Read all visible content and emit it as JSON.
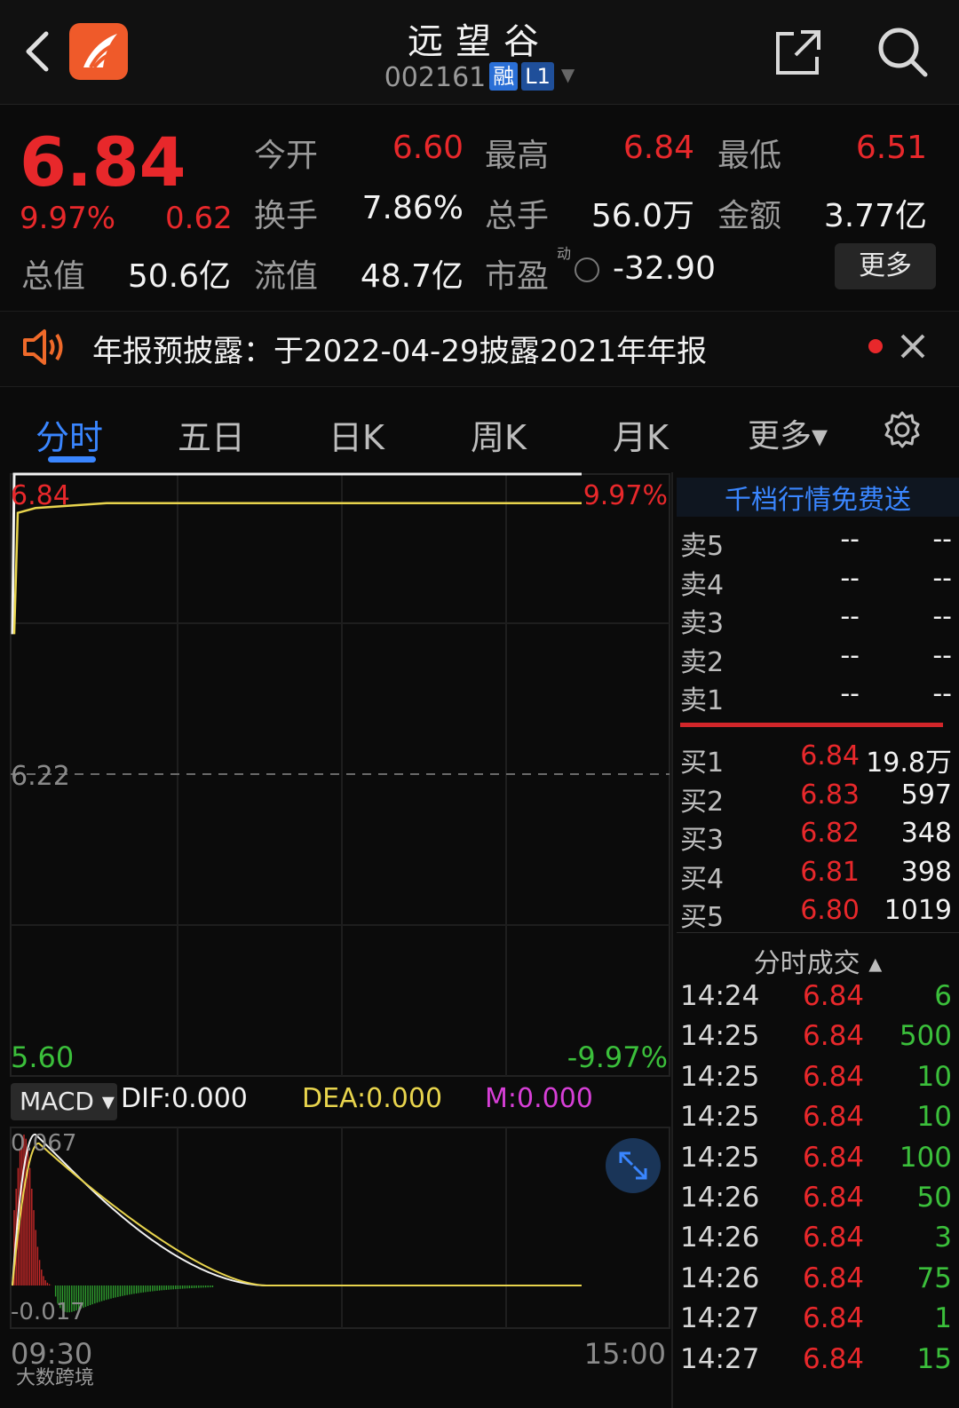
{
  "header": {
    "stock_name": "远望谷",
    "stock_code": "002161",
    "tag_margin": "融",
    "tag_level": "L1"
  },
  "quote": {
    "price": "6.84",
    "pct_change": "9.97%",
    "change": "0.62",
    "fields": [
      {
        "label": "今开",
        "value": "6.60",
        "color": "red"
      },
      {
        "label": "最高",
        "value": "6.84",
        "color": "red"
      },
      {
        "label": "最低",
        "value": "6.51",
        "color": "red"
      },
      {
        "label": "换手",
        "value": "7.86%",
        "color": "white"
      },
      {
        "label": "总手",
        "value": "56.0万",
        "color": "white"
      },
      {
        "label": "金额",
        "value": "3.77亿",
        "color": "white"
      },
      {
        "label": "总值",
        "value": "50.6亿",
        "color": "white"
      },
      {
        "label": "流值",
        "value": "48.7亿",
        "color": "white"
      },
      {
        "label": "市盈",
        "value": "-32.90",
        "color": "white"
      }
    ],
    "pe_mark": "动",
    "more_label": "更多"
  },
  "notice": {
    "text": "年报预披露：于2022-04-29披露2021年年报"
  },
  "tabs": [
    {
      "label": "分时",
      "active": true
    },
    {
      "label": "五日"
    },
    {
      "label": "日K"
    },
    {
      "label": "周K"
    },
    {
      "label": "月K"
    },
    {
      "label": "更多▾"
    }
  ],
  "chart": {
    "price_top": "6.84",
    "pct_top": "9.97%",
    "price_mid": "6.22",
    "price_bottom": "5.60",
    "pct_bottom": "-9.97%",
    "time_start": "09:30",
    "time_end": "15:00",
    "macd_label": "MACD ▾",
    "dif": "DIF:0.000",
    "dea": "DEA:0.000",
    "m": "M:0.000",
    "macd_top": "0.067",
    "macd_bottom": "-0.017",
    "watermark": "大数跨境"
  },
  "chart_data": {
    "type": "line",
    "title": "",
    "ylim": [
      5.6,
      6.84
    ],
    "y_mid": 6.22,
    "x": [
      "09:30",
      "15:00"
    ],
    "series": [
      {
        "values": [
          6.51,
          6.84,
          6.84,
          6.84,
          6.84,
          6.84
        ]
      },
      {
        "values": [
          6.51,
          6.76,
          6.77,
          6.78,
          6.78,
          6.78,
          6.78
        ]
      }
    ]
  },
  "depth": {
    "promo": "千档行情免费送",
    "asks": [
      {
        "label": "卖5",
        "price": "--",
        "vol": "--"
      },
      {
        "label": "卖4",
        "price": "--",
        "vol": "--"
      },
      {
        "label": "卖3",
        "price": "--",
        "vol": "--"
      },
      {
        "label": "卖2",
        "price": "--",
        "vol": "--"
      },
      {
        "label": "卖1",
        "price": "--",
        "vol": "--"
      }
    ],
    "bids": [
      {
        "label": "买1",
        "price": "6.84",
        "vol": "19.8万"
      },
      {
        "label": "买2",
        "price": "6.83",
        "vol": "597"
      },
      {
        "label": "买3",
        "price": "6.82",
        "vol": "348"
      },
      {
        "label": "买4",
        "price": "6.81",
        "vol": "398"
      },
      {
        "label": "买5",
        "price": "6.80",
        "vol": "1019"
      }
    ]
  },
  "ticks": {
    "title": "分时成交 ▴",
    "rows": [
      {
        "time": "14:24",
        "price": "6.84",
        "vol": "6"
      },
      {
        "time": "14:25",
        "price": "6.84",
        "vol": "500"
      },
      {
        "time": "14:25",
        "price": "6.84",
        "vol": "10"
      },
      {
        "time": "14:25",
        "price": "6.84",
        "vol": "10"
      },
      {
        "time": "14:25",
        "price": "6.84",
        "vol": "100"
      },
      {
        "time": "14:26",
        "price": "6.84",
        "vol": "50"
      },
      {
        "time": "14:26",
        "price": "6.84",
        "vol": "3"
      },
      {
        "time": "14:26",
        "price": "6.84",
        "vol": "75"
      },
      {
        "time": "14:27",
        "price": "6.84",
        "vol": "1"
      },
      {
        "time": "14:27",
        "price": "6.84",
        "vol": "15"
      }
    ]
  },
  "colors": {
    "up": "#e8282b",
    "down": "#3bbf3b",
    "accent": "#3a86ff",
    "avg_line": "#e8d44d"
  }
}
